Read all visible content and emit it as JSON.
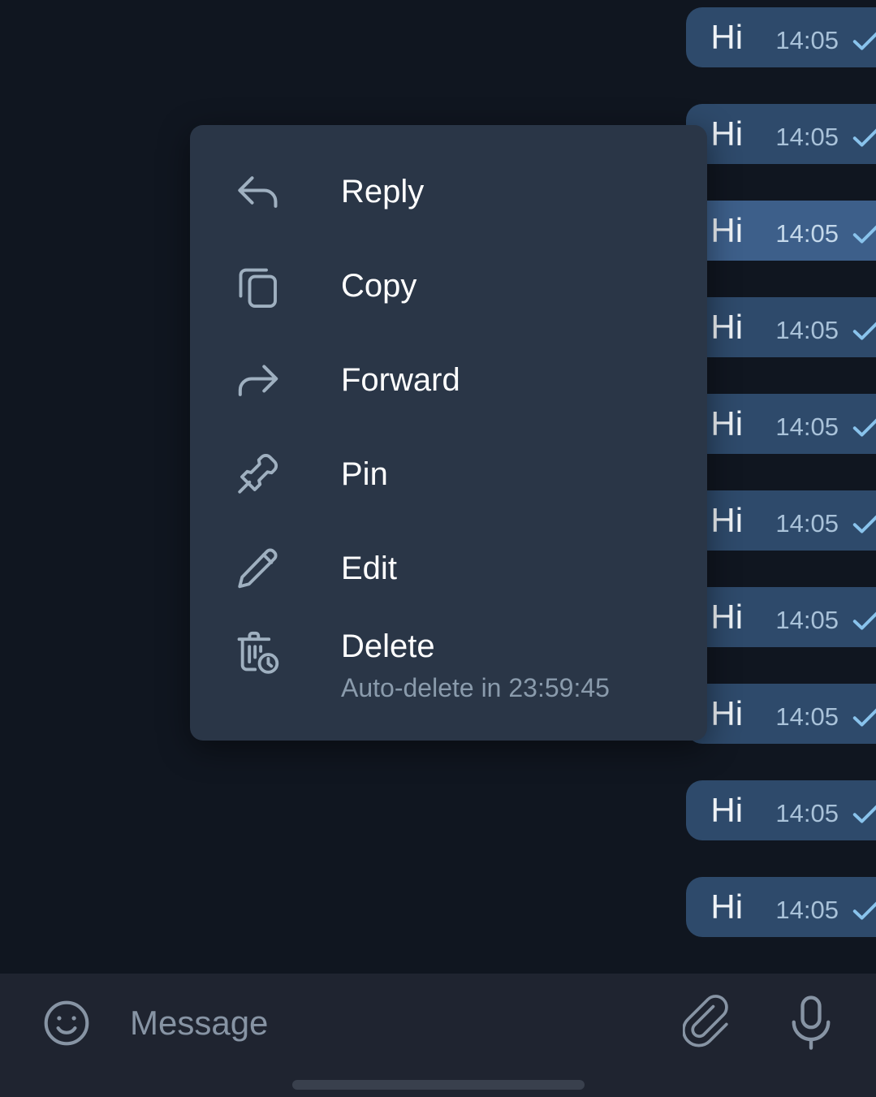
{
  "app": {
    "name": "telegram-chat",
    "theme": "dark",
    "colors": {
      "chat_background": "#101620",
      "menu_background": "#2a3647",
      "bubble_outgoing": "#2e4a6b",
      "bubble_selected": "#3d5f8a",
      "input_bar_background": "#1f2430",
      "label_text": "#ffffff",
      "sub_text": "#8a9bac",
      "icon_tint": "#9fb0c0",
      "check_accent": "#89c3ec",
      "timestamp_text": "#a9c2d9"
    }
  },
  "context_menu": {
    "name": "message-context-menu",
    "items": [
      {
        "label": "Reply",
        "icon": "reply-arrow-icon",
        "subtitle": ""
      },
      {
        "label": "Copy",
        "icon": "copy-icon",
        "subtitle": ""
      },
      {
        "label": "Forward",
        "icon": "forward-arrow-icon",
        "subtitle": ""
      },
      {
        "label": "Pin",
        "icon": "pin-icon",
        "subtitle": ""
      },
      {
        "label": "Edit",
        "icon": "pencil-icon",
        "subtitle": ""
      },
      {
        "label": "Delete",
        "icon": "trash-timer-icon",
        "subtitle": "Auto-delete in 23:59:45"
      }
    ]
  },
  "chat": {
    "messages": [
      {
        "text": "",
        "time": "14:05",
        "status": "sent",
        "selected": false,
        "clipped_top": true,
        "tail": false
      },
      {
        "text": "Hi",
        "time": "14:05",
        "status": "sent",
        "selected": false,
        "clipped_top": false,
        "tail": false
      },
      {
        "text": "Hi",
        "time": "14:05",
        "status": "sent",
        "selected": false,
        "clipped_top": false,
        "tail": false
      },
      {
        "text": "Hi",
        "time": "14:05",
        "status": "sent",
        "selected": true,
        "clipped_top": false,
        "tail": false
      },
      {
        "text": "Hi",
        "time": "14:05",
        "status": "sent",
        "selected": false,
        "clipped_top": false,
        "tail": false
      },
      {
        "text": "Hi",
        "time": "14:05",
        "status": "sent",
        "selected": false,
        "clipped_top": false,
        "tail": false
      },
      {
        "text": "Hi",
        "time": "14:05",
        "status": "sent",
        "selected": false,
        "clipped_top": false,
        "tail": false
      },
      {
        "text": "Hi",
        "time": "14:05",
        "status": "sent",
        "selected": false,
        "clipped_top": false,
        "tail": false
      },
      {
        "text": "Hi",
        "time": "14:05",
        "status": "sent",
        "selected": false,
        "clipped_top": false,
        "tail": false
      },
      {
        "text": "Hi",
        "time": "14:05",
        "status": "sent",
        "selected": false,
        "clipped_top": false,
        "tail": false
      },
      {
        "text": "Hi",
        "time": "14:05",
        "status": "sent",
        "selected": false,
        "clipped_top": false,
        "tail": true
      }
    ]
  },
  "input_bar": {
    "emoji_icon": "smiley-icon",
    "placeholder": "Message",
    "value": "",
    "attach_icon": "paperclip-icon",
    "mic_icon": "microphone-icon"
  }
}
